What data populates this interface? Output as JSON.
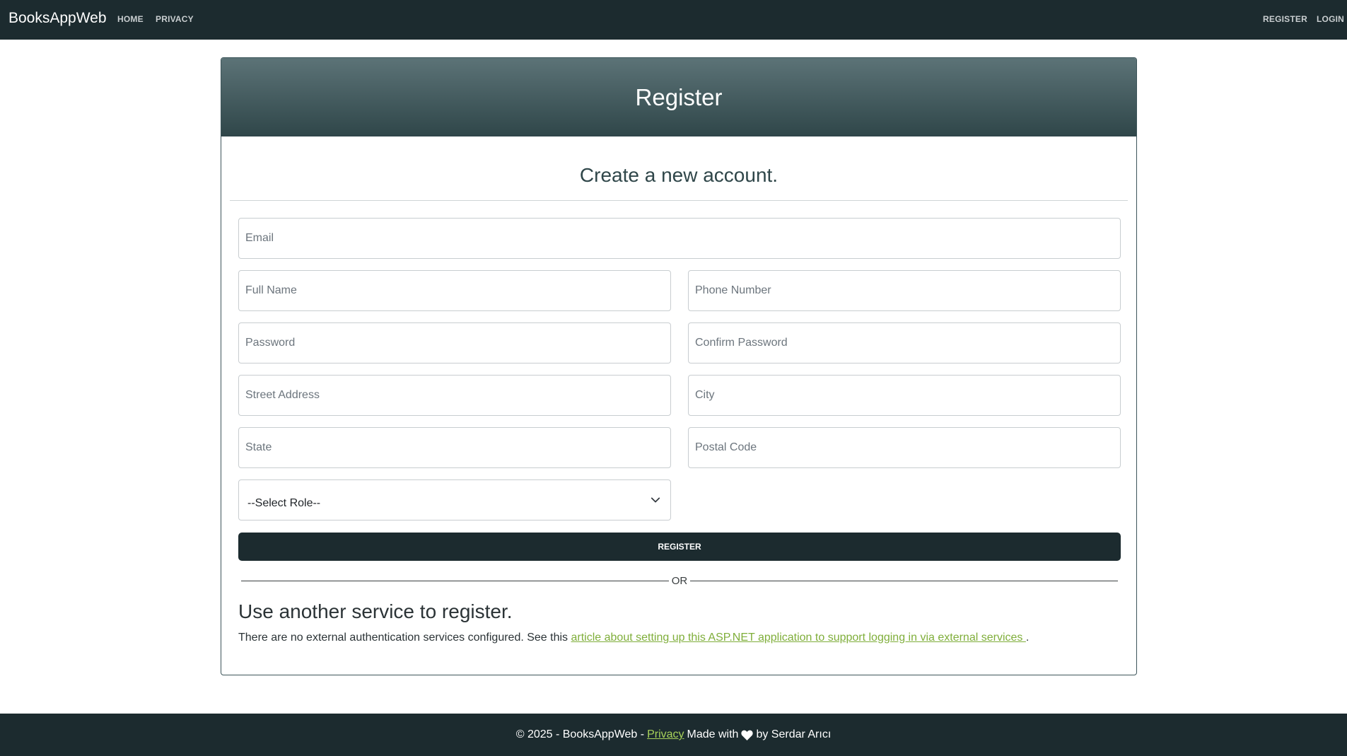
{
  "navbar": {
    "brand": "BooksAppWeb",
    "links": [
      "HOME",
      "PRIVACY"
    ],
    "right_links": [
      "REGISTER",
      "LOGIN"
    ]
  },
  "card": {
    "header_title": "Register",
    "subtitle": "Create a new account.",
    "fields": {
      "email": "Email",
      "full_name": "Full Name",
      "phone_number": "Phone Number",
      "password": "Password",
      "confirm_password": "Confirm Password",
      "street_address": "Street Address",
      "city": "City",
      "state": "State",
      "postal_code": "Postal Code"
    },
    "role_select": {
      "selected": "--Select Role--"
    },
    "register_button": "REGISTER",
    "or_text": "OR",
    "external": {
      "title": "Use another service to register.",
      "text_before": "There are no external authentication services configured. See this ",
      "link_text": "article about setting up this ASP.NET application to support logging in via external services ",
      "text_after": "."
    }
  },
  "footer": {
    "copyright": "© 2025 - BooksAppWeb -",
    "privacy_link": "Privacy",
    "made_with": "Made with",
    "by": "by Serdar Arıcı"
  },
  "colors": {
    "navbar_bg": "#1c2b2f",
    "header_gradient_top": "#5c7377",
    "header_gradient_bottom": "#2f4649",
    "link_green": "#7fae3a",
    "footer_link": "#a8d25a"
  }
}
